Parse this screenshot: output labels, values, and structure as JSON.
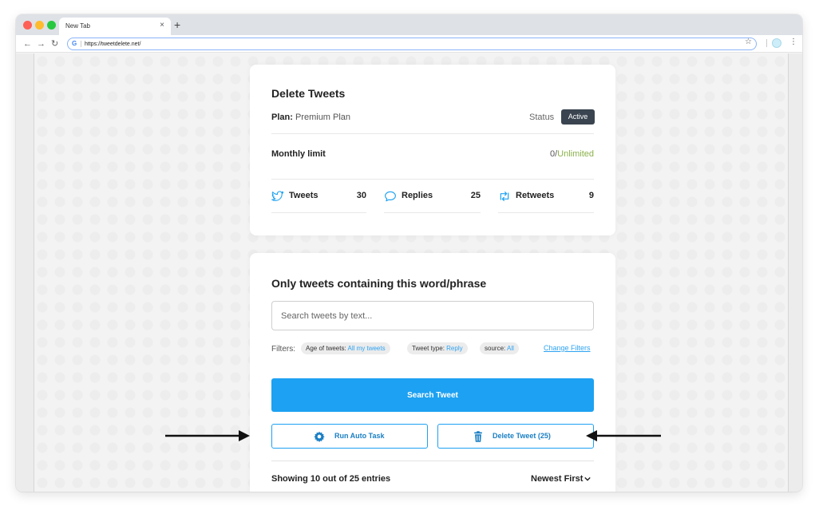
{
  "browser": {
    "tab_title": "New Tab",
    "tab_close": "×",
    "new_tab": "+",
    "url": "https://tweetdelete.net/",
    "icons": [
      "back-icon",
      "forward-icon",
      "reload-icon",
      "google-icon",
      "star-icon",
      "profile-avatar",
      "more-menu-icon"
    ]
  },
  "account_card": {
    "title": "Delete Tweets",
    "plan_label": "Plan:",
    "plan_value": "Premium Plan",
    "status_label": "Status",
    "status_value": "Active",
    "limit_label": "Monthly limit",
    "limit_used": "0/",
    "limit_total": "Unlimited",
    "stats": [
      {
        "label": "Tweets",
        "value": "30",
        "icon": "twitter-bird-icon"
      },
      {
        "label": "Replies",
        "value": "25",
        "icon": "speech-bubble-icon"
      },
      {
        "label": "Retweets",
        "value": "9",
        "icon": "retweet-icon"
      }
    ]
  },
  "search_card": {
    "title": "Only tweets containing this word/phrase",
    "search_placeholder": "Search tweets by text...",
    "filters_label": "Filters:",
    "filters": [
      {
        "key": "Age of tweets:",
        "value": "All my tweets"
      },
      {
        "key": "Tweet type:",
        "value": "Reply"
      },
      {
        "key": "source:",
        "value": "All"
      }
    ],
    "change_filters": "Change Filters",
    "search_button": "Search Tweet",
    "auto_task_button": "Run Auto Task",
    "delete_button": "Delete Tweet (25)",
    "showing_text": "Showing 10 out of 25 entries",
    "sort_label": "Newest First"
  },
  "colors": {
    "accent": "#1da1f2",
    "status_badge": "#3a4450",
    "unlimited": "#8bb14a"
  }
}
